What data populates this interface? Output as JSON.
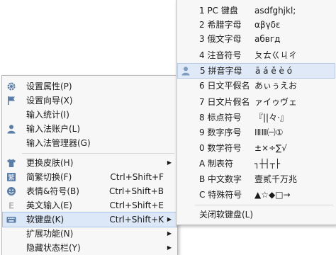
{
  "main_menu": {
    "items": [
      {
        "label": "设置属性(P)",
        "icon": "gear-icon"
      },
      {
        "label": "设置向导(X)",
        "icon": "flag-icon"
      },
      {
        "label": "输入统计(I)",
        "icon": ""
      },
      {
        "label": "输入法账户(L)",
        "icon": "user-icon"
      },
      {
        "label": "输入法管理器(G)",
        "icon": ""
      },
      {
        "label": "更换皮肤(H)",
        "icon": "shirt-icon"
      },
      {
        "label": "简繁切换(F)",
        "icon": "simplified-traditional-icon",
        "shortcut": "Ctrl+Shift+F"
      },
      {
        "label": "表情&符号(B)",
        "icon": "smiley-icon",
        "shortcut": "Ctrl+Shift+B"
      },
      {
        "label": "英文输入(E)",
        "icon": "english-icon",
        "shortcut": "Ctrl+Shift+E"
      },
      {
        "label": "软键盘(K)",
        "icon": "keyboard-icon",
        "shortcut": "Ctrl+Shift+K"
      },
      {
        "label": "扩展功能(N)",
        "icon": ""
      },
      {
        "label": "隐藏状态栏(Y)",
        "icon": ""
      }
    ]
  },
  "soft_keyboard_menu": {
    "items": [
      {
        "label": "1 PC 键盘",
        "sample": "asdfghjkl;"
      },
      {
        "label": "2 希腊字母",
        "sample": "αβγδε"
      },
      {
        "label": "3 俄文字母",
        "sample": "абвгд"
      },
      {
        "label": "4 注音符号",
        "sample": "ㄆㄊㄍㄐㄔ"
      },
      {
        "label": "5 拼音字母",
        "sample": "ā á ě è ó"
      },
      {
        "label": "6 日文平假名",
        "sample": "あぃぅえお"
      },
      {
        "label": "7 日文片假名",
        "sample": "ァイゥヴェ"
      },
      {
        "label": "8 标点符号",
        "sample": "『||々·』"
      },
      {
        "label": "9 数字序号",
        "sample": "ⅠⅡⅢ㈠①"
      },
      {
        "label": "0 数学符号",
        "sample": "±×÷∑√"
      },
      {
        "label": "A 制表符",
        "sample": "┐┼┤┬├"
      },
      {
        "label": "B 中文数字",
        "sample": "壹贰千万兆"
      },
      {
        "label": "C 特殊符号",
        "sample": "▲☆◆□→"
      },
      {
        "label": "关闭软键盘(L)",
        "sample": ""
      }
    ]
  }
}
